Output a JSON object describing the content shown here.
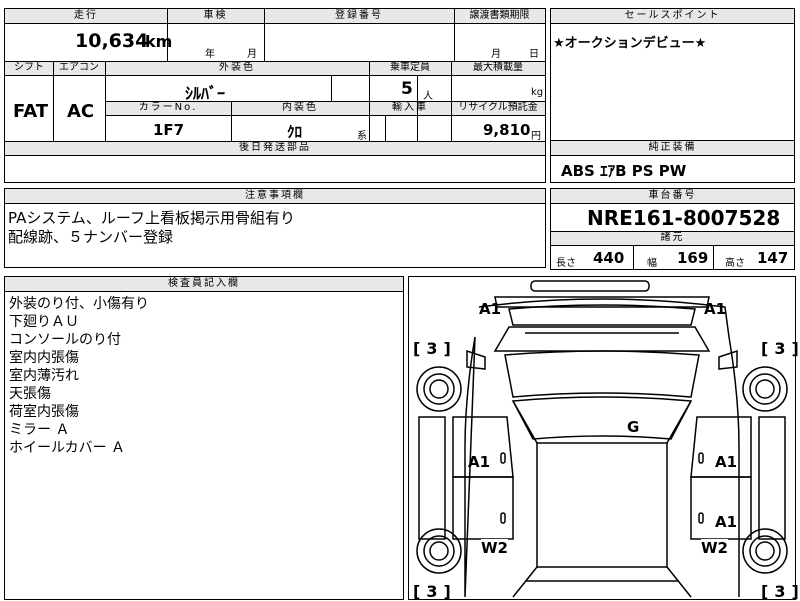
{
  "top_table": {
    "headers": {
      "mileage": "走行",
      "inspection": "車検",
      "registration": "登録番号",
      "transfer_deadline": "譲渡書類期限",
      "shift": "シフト",
      "aircon": "エアコン",
      "exterior_color": "外装色",
      "capacity": "乗車定員",
      "max_load": "最大積載量",
      "color_no": "カラーNo.",
      "interior_color": "内装色",
      "import": "輸入車",
      "recycle_fee": "リサイクル預託金",
      "later_parts": "後日発送部品"
    },
    "mileage_value": "10,634",
    "mileage_unit": "km",
    "inspection_year_unit": "年",
    "inspection_month_unit": "月",
    "deadline_month_unit": "月",
    "deadline_day_unit": "日",
    "shift_value": "FAT",
    "aircon_value": "AC",
    "exterior_color_value": "ｼﾙﾊﾞｰ",
    "capacity_value": "5",
    "capacity_unit": "人",
    "max_load_unit": "kg",
    "color_no_value": "1F7",
    "interior_color_value": "ｸﾛ",
    "interior_color_suffix": "系",
    "recycle_fee_value": "9,810",
    "recycle_fee_unit": "円"
  },
  "sales_point": {
    "header": "セールスポイント",
    "text": "★オークションデビュー★"
  },
  "standard_equipment": {
    "header": "純正装備",
    "text": "ABS ｴｱB PS PW"
  },
  "notes": {
    "header": "注意事項欄",
    "lines": [
      "PAシステム、ルーフ上看板掲示用骨組有り",
      "配線跡、５ナンバー登録"
    ]
  },
  "chassis": {
    "header": "車台番号",
    "number": "NRE161-8007528",
    "dims_header": "諸元",
    "length_label": "長さ",
    "length_value": "440",
    "width_label": "幅",
    "width_value": "169",
    "height_label": "高さ",
    "height_value": "147"
  },
  "inspector": {
    "header": "検査員記入欄",
    "lines": [
      "外装のり付、小傷有り",
      "下廻りＡＵ",
      "コンソールのり付",
      "室内内張傷",
      "室内薄汚れ",
      "天張傷",
      "荷室内張傷",
      "ミラー Ａ",
      "ホイールカバー Ａ"
    ]
  },
  "diagram": {
    "marks": {
      "front_left": "A1",
      "front_right": "A1",
      "tire_fl": "3",
      "tire_fr": "3",
      "roof": "G",
      "door_l": "A1",
      "door_r": "A1",
      "door_r2": "A1",
      "rear_fender_l": "W2",
      "rear_fender_r": "W2",
      "tire_rl": "3",
      "tire_rr": "3"
    }
  }
}
